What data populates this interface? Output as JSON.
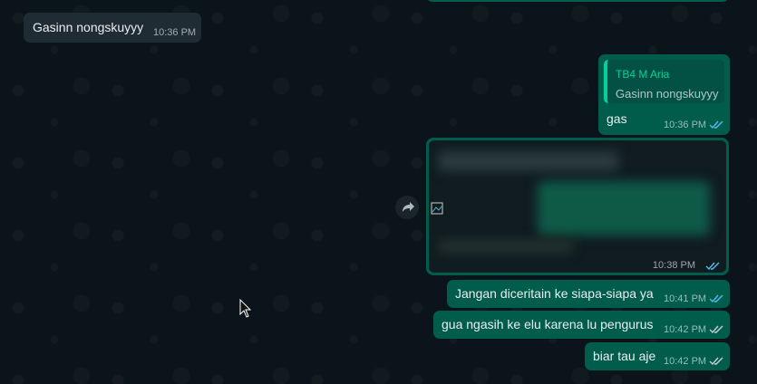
{
  "chat": {
    "incoming": [
      {
        "text": "Gasinn nongskuyyy",
        "time": "10:36 PM"
      }
    ],
    "reply": {
      "quote_author": "TB4 M Aria",
      "quote_text": "Gasinn nongskuyyy",
      "text": "gas",
      "time": "10:36 PM"
    },
    "media": {
      "time": "10:38 PM"
    },
    "outgoing": [
      {
        "text": "Jangan diceritain ke siapa-siapa ya",
        "time": "10:41 PM"
      },
      {
        "text": "gua ngasih ke elu karena lu pengurus",
        "time": "10:42 PM"
      },
      {
        "text": "biar tau aje",
        "time": "10:42 PM"
      }
    ]
  },
  "colors": {
    "background": "#0b141a",
    "incoming_bubble": "#202c33",
    "outgoing_bubble": "#005c4b",
    "quote_accent": "#06cf9c",
    "read_tick": "#53bdeb"
  },
  "icons": {
    "forward": "forward-arrow-icon",
    "read_receipt": "double-check-icon",
    "cursor": "mouse-pointer-icon"
  }
}
